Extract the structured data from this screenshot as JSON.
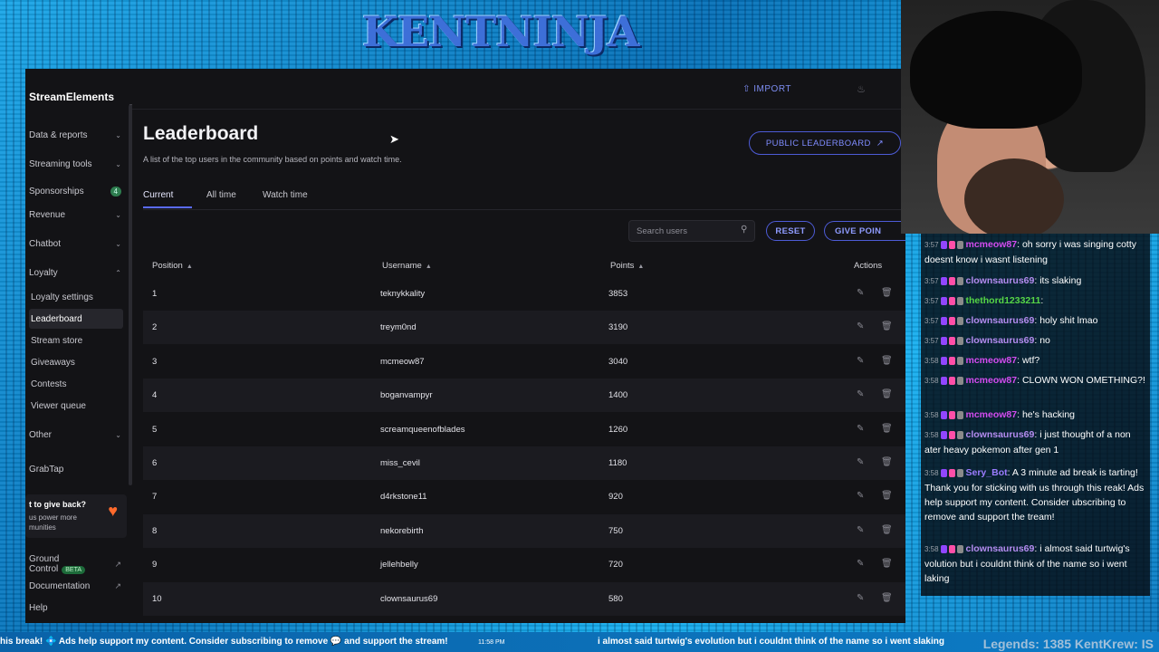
{
  "overlay": {
    "banner": "KENTNINJA",
    "ticker_text": "his break! 💠 Ads help support my content. Consider subscribing to remove 💬 and support the stream!",
    "ticker_time": "11:58 PM",
    "ticker_text2": "i almost said turtwig's evolution but i couldnt think of the name so i went slaking",
    "legends": "Legends: 1385  KentKrew: IS"
  },
  "sidebar": {
    "brand": "StreamElements",
    "items": [
      {
        "label": "Data & reports",
        "chevron": "⌄"
      },
      {
        "label": "Streaming tools",
        "chevron": "⌄"
      },
      {
        "label": "Sponsorships",
        "badge": "4"
      },
      {
        "label": "Revenue",
        "chevron": "⌄"
      },
      {
        "label": "Chatbot",
        "chevron": "⌄"
      },
      {
        "label": "Loyalty",
        "chevron": "⌃"
      },
      {
        "label": "Loyalty settings"
      },
      {
        "label": "Leaderboard"
      },
      {
        "label": "Stream store"
      },
      {
        "label": "Giveaways"
      },
      {
        "label": "Contests"
      },
      {
        "label": "Viewer queue"
      },
      {
        "label": "Other",
        "chevron": "⌄"
      },
      {
        "label": "GrabTap"
      },
      {
        "label": "Ground Control",
        "beta": "BETA"
      },
      {
        "label": "Documentation"
      },
      {
        "label": "Help"
      }
    ],
    "giveback": {
      "title": "t to give back?",
      "text": "us power more munities"
    }
  },
  "topbar": {
    "import_label": "IMPORT"
  },
  "page": {
    "title": "Leaderboard",
    "subtitle": "A list of the top users in the community based on points and watch time.",
    "public_button": "PUBLIC LEADERBOARD",
    "tabs": [
      "Current",
      "All time",
      "Watch time"
    ],
    "search_placeholder": "Search users",
    "reset_button": "RESET",
    "give_button": "GIVE POIN"
  },
  "table": {
    "headers": [
      "Position",
      "Username",
      "Points",
      "Actions"
    ],
    "rows": [
      {
        "position": "1",
        "username": "teknykkality",
        "points": "3853"
      },
      {
        "position": "2",
        "username": "treym0nd",
        "points": "3190"
      },
      {
        "position": "3",
        "username": "mcmeow87",
        "points": "3040"
      },
      {
        "position": "4",
        "username": "boganvampyr",
        "points": "1400"
      },
      {
        "position": "5",
        "username": "screamqueenofblades",
        "points": "1260"
      },
      {
        "position": "6",
        "username": "miss_cevil",
        "points": "1180"
      },
      {
        "position": "7",
        "username": "d4rkstone11",
        "points": "920"
      },
      {
        "position": "8",
        "username": "nekorebirth",
        "points": "750"
      },
      {
        "position": "9",
        "username": "jellehbelly",
        "points": "720"
      },
      {
        "position": "10",
        "username": "clownsaurus69",
        "points": "580"
      }
    ]
  },
  "chat": {
    "messages": [
      {
        "time": "3:57",
        "user": "mcmeow87",
        "text": "oh sorry i was singing cotty doesnt know i wasnt listening"
      },
      {
        "time": "3:57",
        "user": "clownsaurus69",
        "text": "its slaking"
      },
      {
        "time": "3:57",
        "user": "thethord1233211",
        "text": ""
      },
      {
        "time": "3:57",
        "user": "clownsaurus69",
        "text": "holy shit lmao"
      },
      {
        "time": "3:57",
        "user": "clownsaurus69",
        "text": "no"
      },
      {
        "time": "3:58",
        "user": "mcmeow87",
        "text": "wtf?"
      },
      {
        "time": "3:58",
        "user": "mcmeow87",
        "text": "CLOWN WON OMETHING?!"
      },
      {
        "time": "3:58",
        "user": "mcmeow87",
        "text": "he's hacking"
      },
      {
        "time": "3:58",
        "user": "clownsaurus69",
        "text": "i just thought of a non ater heavy pokemon after gen 1"
      },
      {
        "time": "3:58",
        "user": "Sery_Bot",
        "text": "A 3 minute ad break is tarting! Thank you for sticking with us through this reak! Ads help support my content. Consider ubscribing to remove and support the tream!"
      },
      {
        "time": "3:58",
        "user": "clownsaurus69",
        "text": "i almost said turtwig's volution but i couldnt think of the name so i went laking"
      }
    ]
  }
}
